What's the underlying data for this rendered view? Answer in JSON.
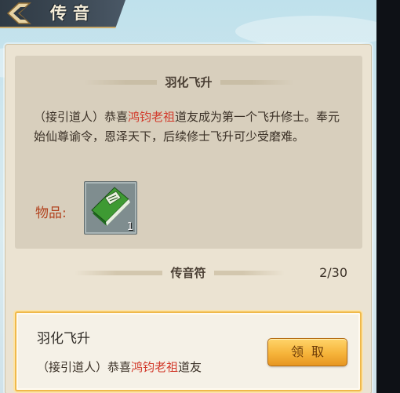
{
  "header": {
    "title": "传音",
    "back_icon": "chevron-left-icon"
  },
  "detail": {
    "title": "羽化飞升",
    "message_parts": [
      {
        "text": "（接引道人）恭喜",
        "highlight": false
      },
      {
        "text": "鸿钧老祖",
        "highlight": true
      },
      {
        "text": "道友成为第一个飞升修士。奉元始仙尊谕令，恩泽天下，后续修士飞升可少受磨难。",
        "highlight": false
      }
    ],
    "items_label": "物品:",
    "item": {
      "icon": "green-book-icon",
      "count": "1"
    }
  },
  "list": {
    "section_title": "传音符",
    "count": "2/30",
    "messages": [
      {
        "title": "羽化飞升",
        "preview_prefix": "（接引道人）恭喜",
        "preview_highlight": "鸿钧老祖",
        "preview_suffix": "道友",
        "claim_label": "领取"
      }
    ]
  },
  "colors": {
    "highlight": "#d23a2b",
    "accent_gold": "#f6b43a",
    "label_red": "#b2431f"
  }
}
